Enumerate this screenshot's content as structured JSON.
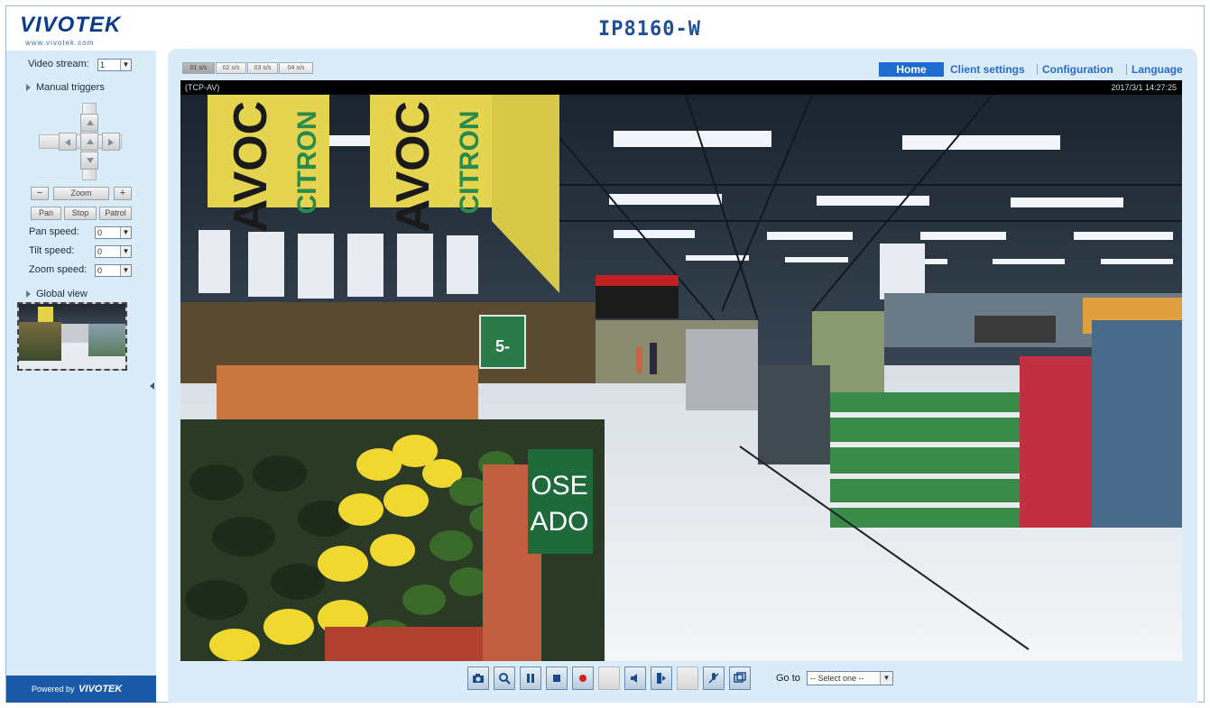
{
  "brand": {
    "logo_text": "VIVOTEK",
    "logo_sub": "www.vivotek.com",
    "model": "IP8160-W",
    "powered_by": "Powered by",
    "powered_brand": "VIVOTEK"
  },
  "sidebar": {
    "video_stream_label": "Video stream:",
    "video_stream_value": "1",
    "manual_triggers_label": "Manual triggers",
    "zoom_label": "Zoom",
    "zoom_minus": "−",
    "zoom_plus": "+",
    "pan_button": "Pan",
    "stop_button": "Stop",
    "patrol_button": "Patrol",
    "pan_speed_label": "Pan speed:",
    "pan_speed_value": "0",
    "tilt_speed_label": "Tilt speed:",
    "tilt_speed_value": "0",
    "zoom_speed_label": "Zoom speed:",
    "zoom_speed_value": "0",
    "global_view_label": "Global view"
  },
  "stream_tabs": [
    "01 s/s",
    "02 s/s",
    "03 s/s",
    "04 s/s"
  ],
  "nav": {
    "home": "Home",
    "client_settings": "Client settings",
    "configuration": "Configuration",
    "language": "Language"
  },
  "video": {
    "protocol": "(TCP-AV)",
    "timestamp": "2017/3/1 14:27:25",
    "sign_text_1": "AVOC",
    "sign_text_1b": "CITRON",
    "sign_text_2": "AVOC",
    "sign_text_2b": "CITRON",
    "price_tag": "5-",
    "green_sign_1": "OSE",
    "green_sign_2": "ADO"
  },
  "toolbar": {
    "buttons": [
      "snapshot-icon",
      "zoom-icon",
      "pause-icon",
      "stop-icon",
      "record-icon",
      "blank-icon",
      "volume-icon",
      "talk-icon",
      "mic-icon",
      "view-size-icon",
      "fullscreen-icon"
    ],
    "goto_label": "Go to",
    "goto_value": "-- Select one --"
  },
  "colors": {
    "panel_bg": "#dbecf9",
    "accent": "#1e6cd0",
    "title": "#1f4f9a",
    "powered_bg": "#1a5aa8"
  }
}
